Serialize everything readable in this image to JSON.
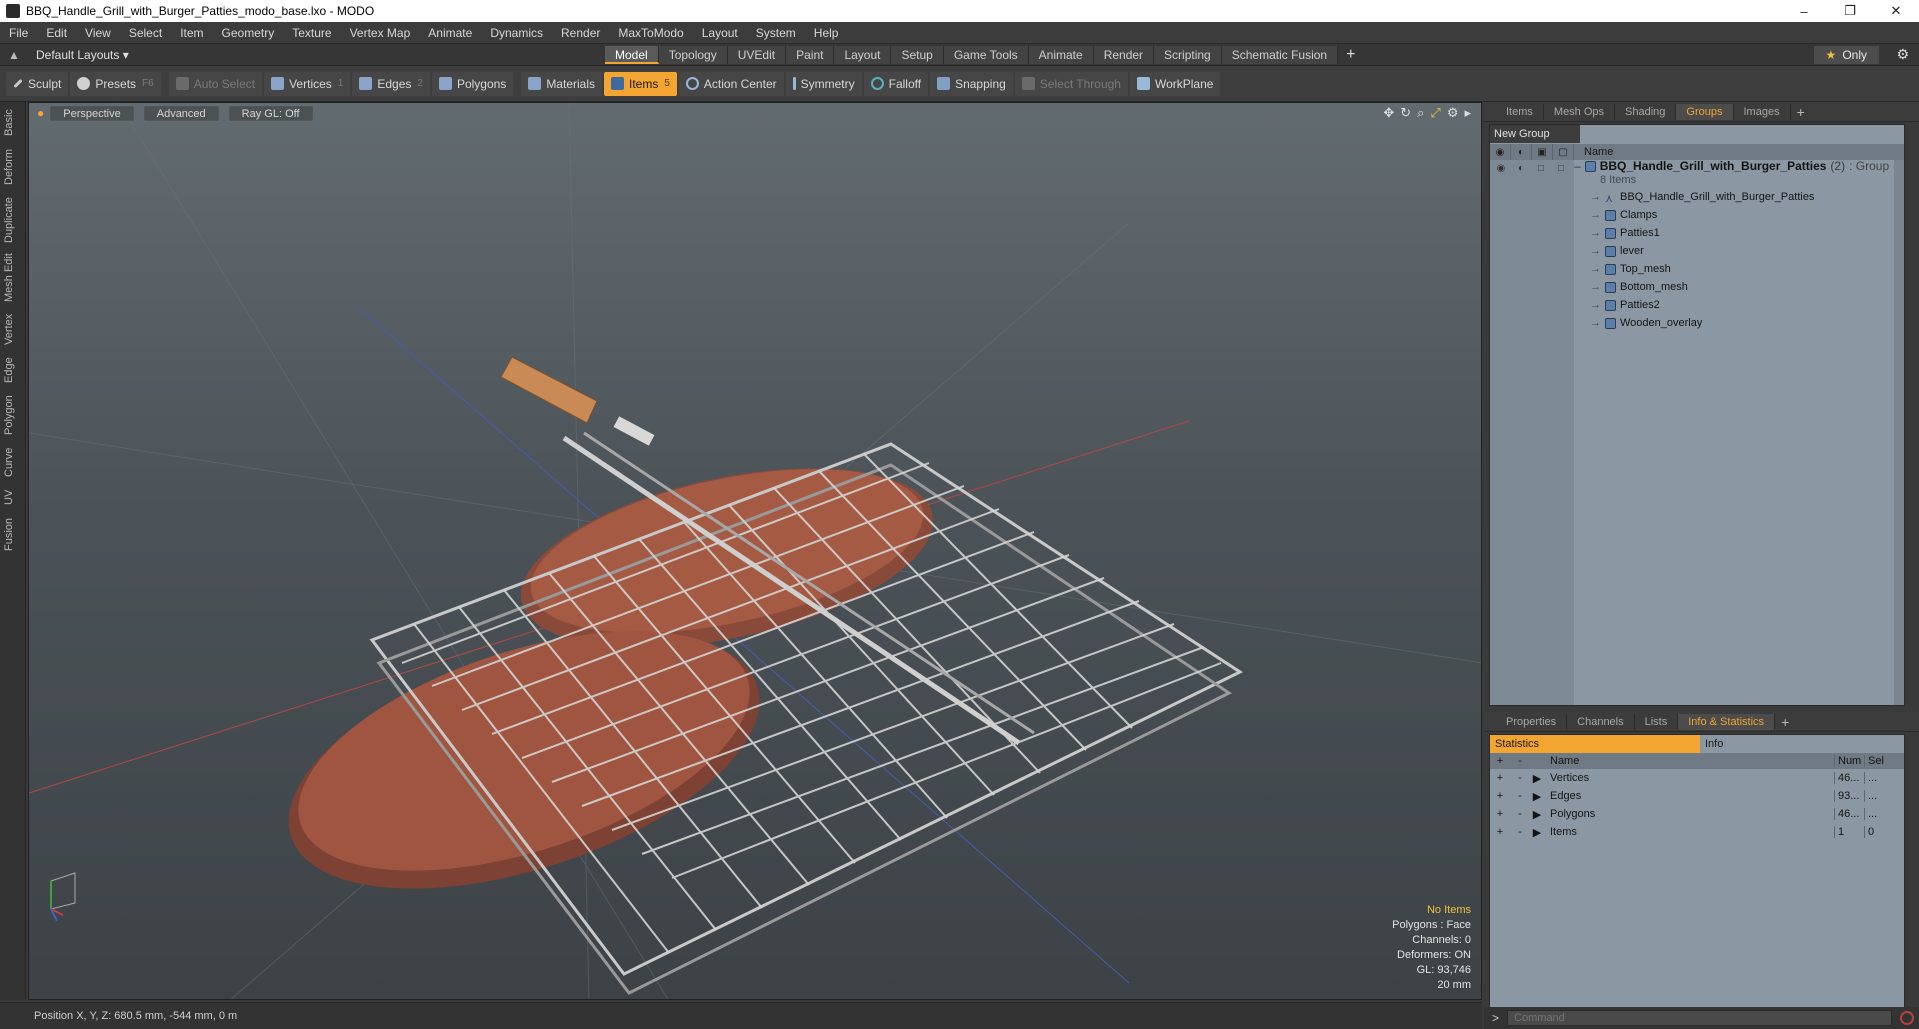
{
  "window": {
    "title": "BBQ_Handle_Grill_with_Burger_Patties_modo_base.lxo - MODO",
    "min_glyph": "–",
    "max_glyph": "❐",
    "close_glyph": "✕"
  },
  "menu": [
    "File",
    "Edit",
    "View",
    "Select",
    "Item",
    "Geometry",
    "Texture",
    "Vertex Map",
    "Animate",
    "Dynamics",
    "Render",
    "MaxToModo",
    "Layout",
    "System",
    "Help"
  ],
  "layoutbar": {
    "default_layouts": "Default Layouts ▾",
    "tabs": [
      "Model",
      "Topology",
      "UVEdit",
      "Paint",
      "Layout",
      "Setup",
      "Game Tools",
      "Animate",
      "Render",
      "Scripting",
      "Schematic Fusion"
    ],
    "active_tab": "Model",
    "plus": "+",
    "only_star": "★",
    "only_label": "Only",
    "gear": "⚙"
  },
  "toolbar": {
    "sculpt": "Sculpt",
    "presets": "Presets",
    "presets_key": "F6",
    "auto_select": "Auto Select",
    "vertices": "Vertices",
    "vertices_key": "1",
    "edges": "Edges",
    "edges_key": "2",
    "polygons": "Polygons",
    "materials": "Materials",
    "items": "Items",
    "items_key": "5",
    "action_center": "Action Center",
    "symmetry": "Symmetry",
    "falloff": "Falloff",
    "snapping": "Snapping",
    "select_through": "Select Through",
    "workplane": "WorkPlane"
  },
  "left_tabs": [
    "Basic",
    "Deform",
    "Duplicate",
    "Mesh Edit",
    "Vertex",
    "Edge",
    "Polygon",
    "Curve",
    "UV",
    "Fusion"
  ],
  "viewport": {
    "perspective": "Perspective",
    "advanced": "Advanced",
    "raygl": "Ray GL: Off",
    "info": {
      "no_items": "No Items",
      "polygons": "Polygons : Face",
      "channels": "Channels: 0",
      "deformers": "Deformers: ON",
      "gl": "GL: 93,746",
      "scale": "20 mm"
    }
  },
  "status": {
    "position": "Position X, Y, Z:   680.5 mm, -544 mm, 0 m"
  },
  "groups_panel": {
    "tabs": [
      "Items",
      "Mesh Ops",
      "Shading",
      "Groups",
      "Images"
    ],
    "active_tab": "Groups",
    "new_group": "New Group",
    "name_header": "Name",
    "root": {
      "name": "BBQ_Handle_Grill_with_Burger_Patties",
      "count": "(2)",
      "type": ": Group",
      "items_count": "8 Items"
    },
    "children": [
      "BBQ_Handle_Grill_with_Burger_Patties",
      "Clamps",
      "Patties1",
      "lever",
      "Top_mesh",
      "Bottom_mesh",
      "Patties2",
      "Wooden_overlay"
    ]
  },
  "stats_panel": {
    "tabs": [
      "Properties",
      "Channels",
      "Lists",
      "Info & Statistics"
    ],
    "active_tab": "Info & Statistics",
    "statistics": "Statistics",
    "info": "Info",
    "col_name": "Name",
    "col_num": "Num",
    "col_sel": "Sel",
    "rows": [
      {
        "name": "Vertices",
        "num": "46...",
        "sel": "..."
      },
      {
        "name": "Edges",
        "num": "93...",
        "sel": "..."
      },
      {
        "name": "Polygons",
        "num": "46...",
        "sel": "..."
      },
      {
        "name": "Items",
        "num": "1",
        "sel": "0"
      }
    ]
  },
  "command": {
    "prompt": ">",
    "placeholder": "Command"
  }
}
